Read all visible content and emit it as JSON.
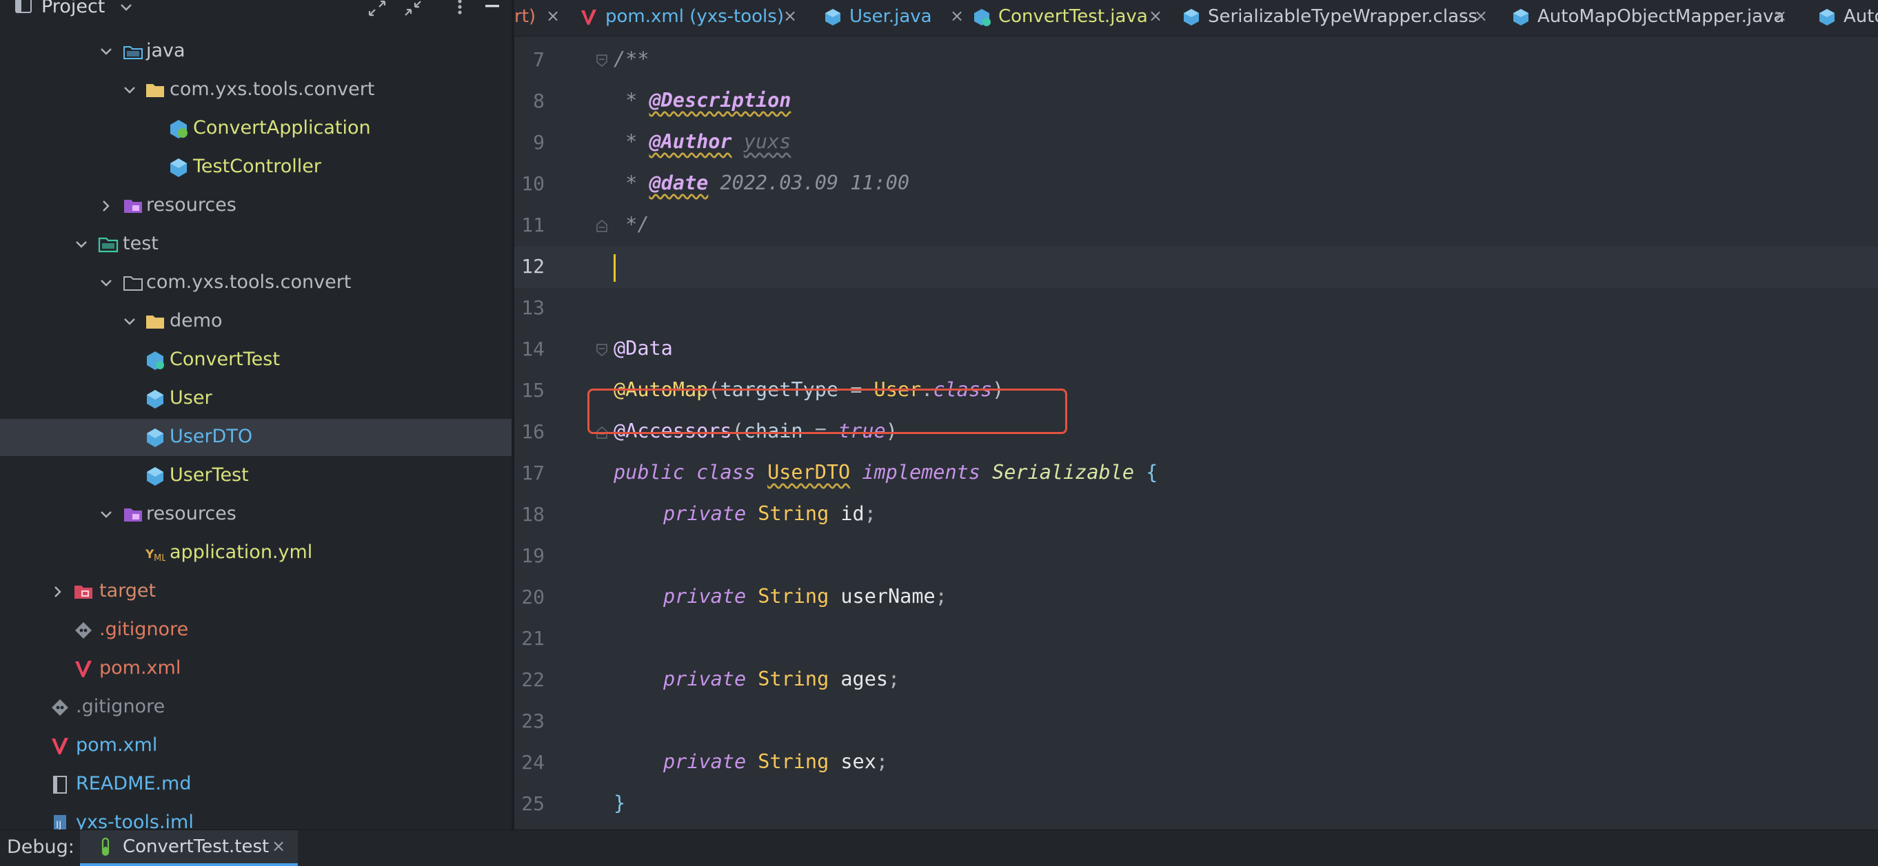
{
  "sidebar": {
    "title": "Project",
    "tree": [
      {
        "label": "java",
        "kind": "source-folder",
        "color": "#c7cbd3"
      },
      {
        "label": "com.yxs.tools.convert",
        "kind": "package",
        "color": "#b6bac2"
      },
      {
        "label": "ConvertApplication",
        "kind": "spring-class",
        "color": "#d9e27a"
      },
      {
        "label": "TestController",
        "kind": "class",
        "color": "#d9e27a"
      },
      {
        "label": "resources",
        "kind": "resources",
        "color": "#b6bac2"
      },
      {
        "label": "test",
        "kind": "test-folder",
        "color": "#b6bac2"
      },
      {
        "label": "com.yxs.tools.convert",
        "kind": "package-outline",
        "color": "#b6bac2"
      },
      {
        "label": "demo",
        "kind": "package",
        "color": "#b6bac2"
      },
      {
        "label": "ConvertTest",
        "kind": "test-class",
        "color": "#d9e27a"
      },
      {
        "label": "User",
        "kind": "class",
        "color": "#d9e27a"
      },
      {
        "label": "UserDTO",
        "kind": "class",
        "color": "#5fb7ee"
      },
      {
        "label": "UserTest",
        "kind": "class",
        "color": "#d9e27a"
      },
      {
        "label": "resources",
        "kind": "resources",
        "color": "#b6bac2"
      },
      {
        "label": "application.yml",
        "kind": "yaml",
        "color": "#d9e27a"
      },
      {
        "label": "target",
        "kind": "excluded",
        "color": "#d68a6a"
      },
      {
        "label": ".gitignore",
        "kind": "gitignore",
        "color": "#e07a5f"
      },
      {
        "label": "pom.xml",
        "kind": "maven",
        "color": "#e07a5f"
      },
      {
        "label": ".gitignore",
        "kind": "gitignore",
        "color": "#8a9099"
      },
      {
        "label": "pom.xml",
        "kind": "maven",
        "color": "#5fb7ee"
      },
      {
        "label": "README.md",
        "kind": "markdown",
        "color": "#5fb7ee"
      },
      {
        "label": "yxs-tools.iml",
        "kind": "iml",
        "color": "#5fb7ee"
      }
    ]
  },
  "tabs": [
    {
      "label": "rt)",
      "color": "#e07a5f",
      "icon": "none"
    },
    {
      "label": "pom.xml (yxs-tools)",
      "color": "#5fb7ee",
      "icon": "maven-icon"
    },
    {
      "label": "User.java",
      "color": "#5fb7ee",
      "icon": "class-icon"
    },
    {
      "label": "ConvertTest.java",
      "color": "#d9e27a",
      "icon": "class-icon"
    },
    {
      "label": "SerializableTypeWrapper.class",
      "color": "#c7cbd3",
      "icon": "class-icon"
    },
    {
      "label": "AutoMapObjectMapper.java",
      "color": "#c7cbd3",
      "icon": "class-icon"
    },
    {
      "label": "Auto",
      "color": "#c7cbd3",
      "icon": "class-icon"
    }
  ],
  "tab_close": "×",
  "editor": {
    "line_numbers": [
      "7",
      "8",
      "9",
      "10",
      "11",
      "12",
      "13",
      "14",
      "15",
      "16",
      "17",
      "18",
      "19",
      "20",
      "21",
      "22",
      "23",
      "24",
      "25"
    ],
    "current_line": "12",
    "code": {
      "l7": "/**",
      "l8_star": " * ",
      "l8_tag": "@Description",
      "l9_star": " * ",
      "l9_tag": "@Author",
      "l9_name": "yuxs",
      "l10_star": " * ",
      "l10_tag": "@date",
      "l10_val": "2022.03.09 11:00",
      "l11": " */",
      "l14": "@Data",
      "l15_ann": "@AutoMap",
      "l15_open": "(",
      "l15_attr": "targetType",
      "l15_eq": " = ",
      "l15_type": "User",
      "l15_dot": ".",
      "l15_kw": "class",
      "l15_close": ")",
      "l16_ann": "@Accessors",
      "l16_open": "(",
      "l16_attr": "chain",
      "l16_eq": " = ",
      "l16_kw": "true",
      "l16_close": ")",
      "l17_kw1": "public class ",
      "l17_cls": "UserDTO",
      "l17_kw2": " implements ",
      "l17_iface": "Serializable",
      "l17_brace": " {",
      "l18_kw": "private ",
      "l18_type": "String ",
      "l18_id": "id",
      "l20_kw": "private ",
      "l20_type": "String ",
      "l20_id": "userName",
      "l22_kw": "private ",
      "l22_type": "String ",
      "l22_id": "ages",
      "l24_kw": "private ",
      "l24_type": "String ",
      "l24_id": "sex",
      "semicolon": ";",
      "l25": "}"
    }
  },
  "bottom": {
    "debug_label": "Debug:",
    "run_config": "ConvertTest.test",
    "close": "×"
  },
  "colors": {
    "highlight_box": "#e2533f",
    "caret": "#f0c430",
    "accent": "#4a9de8"
  }
}
